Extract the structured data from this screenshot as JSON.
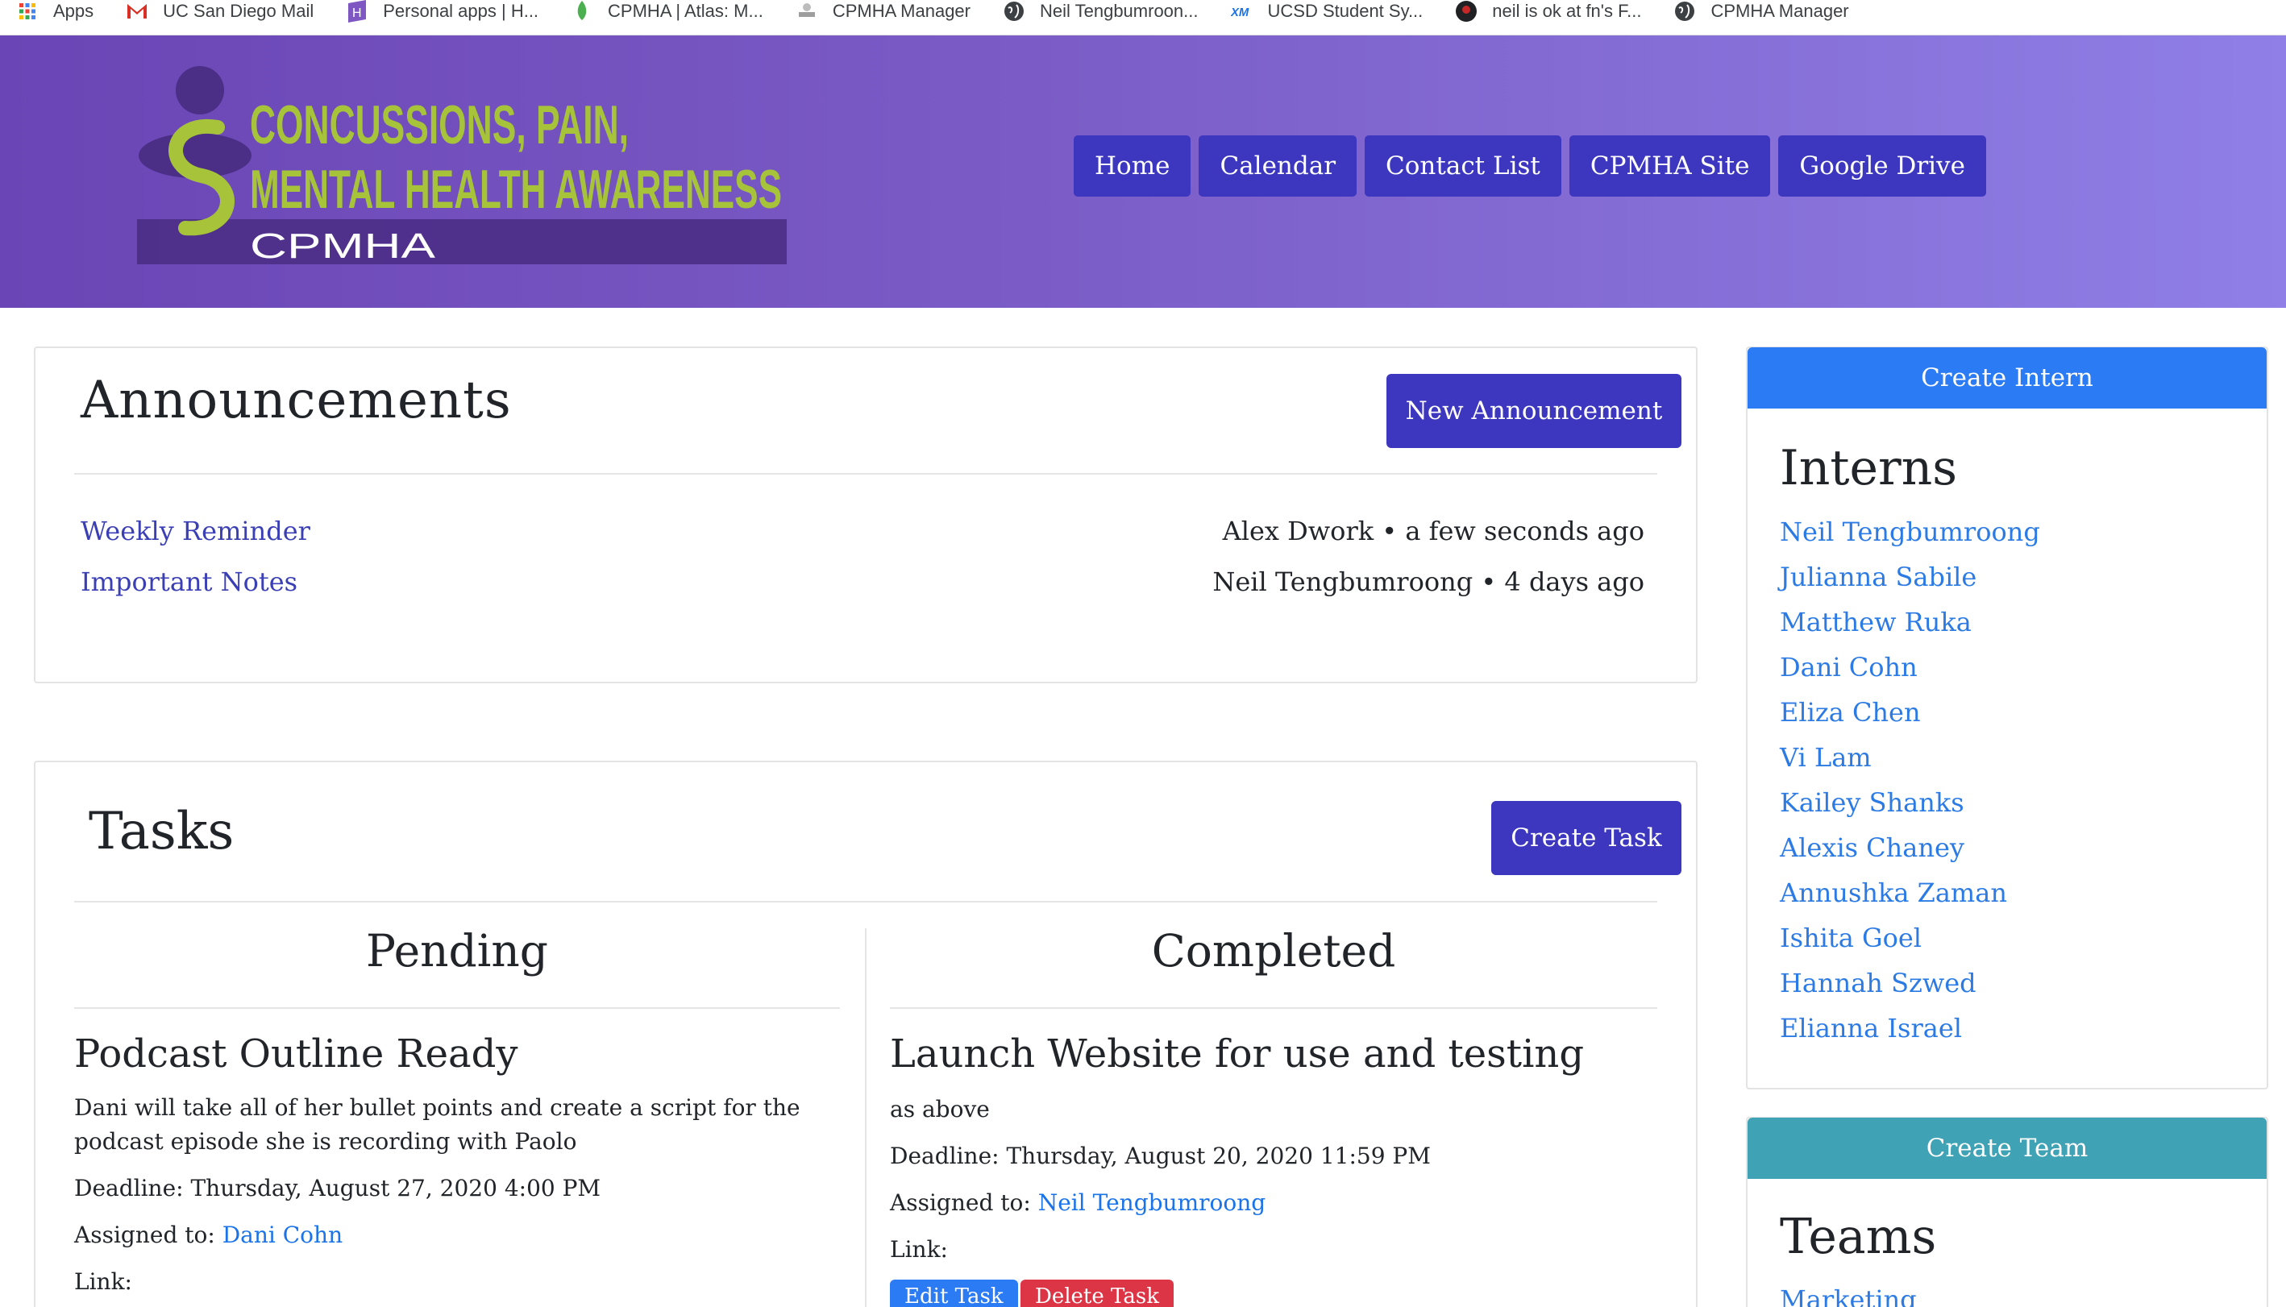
{
  "bookmarks": [
    {
      "label": "Apps",
      "icon": "apps-grid-icon"
    },
    {
      "label": "UC San Diego Mail",
      "icon": "gmail-icon"
    },
    {
      "label": "Personal apps | H...",
      "icon": "h-app-icon"
    },
    {
      "label": "CPMHA | Atlas: M...",
      "icon": "leaf-icon"
    },
    {
      "label": "CPMHA Manager",
      "icon": "manager-icon"
    },
    {
      "label": "Neil Tengbumroon...",
      "icon": "globe-icon"
    },
    {
      "label": "UCSD Student Sy...",
      "icon": "xm-icon"
    },
    {
      "label": "neil is ok at fn's F...",
      "icon": "avatar-icon"
    },
    {
      "label": "CPMHA Manager",
      "icon": "globe-icon"
    }
  ],
  "logo": {
    "line1": "CONCUSSIONS, PAIN,",
    "line2": "MENTAL HEALTH AWARENESS",
    "line3": "CPMHA"
  },
  "nav": [
    "Home",
    "Calendar",
    "Contact List",
    "CPMHA Site",
    "Google Drive"
  ],
  "announcements": {
    "title": "Announcements",
    "new_button": "New Announcement",
    "items": [
      {
        "title": "Weekly Reminder",
        "meta": "Alex Dwork • a few seconds ago"
      },
      {
        "title": "Important Notes",
        "meta": "Neil Tengbumroong • 4 days ago"
      }
    ]
  },
  "tasks": {
    "title": "Tasks",
    "create_button": "Create Task",
    "pending_title": "Pending",
    "completed_title": "Completed",
    "pending": {
      "name": "Podcast Outline Ready",
      "desc_line1": "Dani will take all of her bullet points and create a script for the",
      "desc_line2": "podcast episode she is recording with Paolo",
      "deadline": "Deadline: Thursday, August 27, 2020 4:00 PM",
      "assigned_label": "Assigned to:",
      "assignee": "Dani Cohn",
      "link_label": "Link:"
    },
    "completed": {
      "name": "Launch Website for use and testing",
      "desc": "as above",
      "deadline": "Deadline: Thursday, August 20, 2020 11:59 PM",
      "assigned_label": "Assigned to:",
      "assignee": "Neil Tengbumroong",
      "link_label": "Link:",
      "edit_button": "Edit Task",
      "delete_button": "Delete Task"
    }
  },
  "sidebar": {
    "create_intern": "Create Intern",
    "interns_title": "Interns",
    "interns": [
      "Neil Tengbumroong",
      "Julianna Sabile",
      "Matthew Ruka",
      "Dani Cohn",
      "Eliza Chen",
      "Vi Lam",
      "Kailey Shanks",
      "Alexis Chaney",
      "Annushka Zaman",
      "Ishita Goel",
      "Hannah Szwed",
      "Elianna Israel"
    ],
    "create_team": "Create Team",
    "teams_title": "Teams",
    "teams": [
      "Marketing"
    ]
  },
  "colors": {
    "nav_button": "#3d37c0",
    "create_intern": "#2b7bf5",
    "create_team": "#3fa2b5",
    "edit_task": "#2b7bf5",
    "delete_task": "#dc3545",
    "link": "#2c7be5"
  }
}
